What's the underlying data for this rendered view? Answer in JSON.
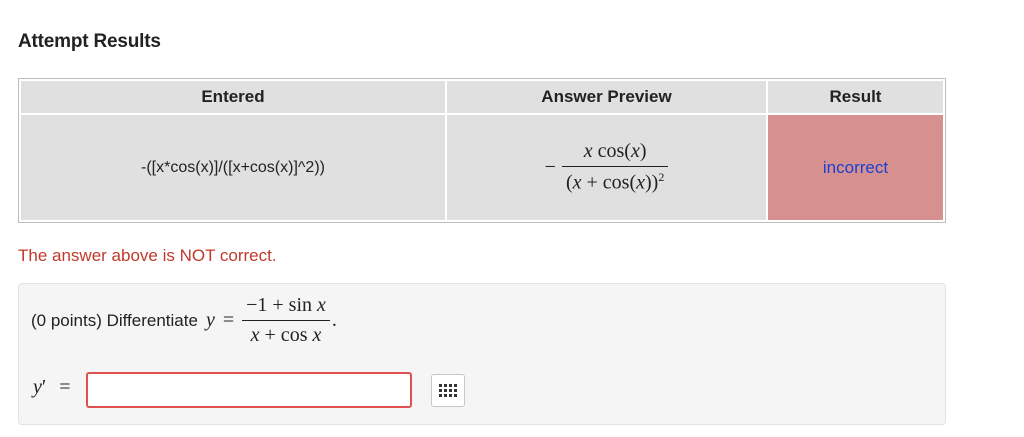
{
  "page": {
    "title": "Attempt Results"
  },
  "table": {
    "headers": {
      "entered": "Entered",
      "preview": "Answer Preview",
      "result": "Result"
    },
    "row": {
      "entered": "-([x*cos(x)]/([x+cos(x)]^2))",
      "preview": {
        "sign": "−",
        "numerator": [
          "x",
          " cos(",
          "x",
          ")"
        ],
        "denominator": [
          "(",
          "x",
          " + cos(",
          "x",
          "))"
        ],
        "exponent": "2"
      },
      "result": "incorrect"
    },
    "colors": {
      "header_bg": "#e0e0e0",
      "cell_bg": "#e0e0e0",
      "incorrect_bg": "#d6908f",
      "incorrect_text": "#1a3fd1"
    }
  },
  "message": {
    "text": "The answer above is NOT correct.",
    "color": "#c0392b"
  },
  "problem": {
    "points": "(0 points) Differentiate",
    "var": "y",
    "equals": "=",
    "fraction": {
      "numerator": "−1 + sin",
      "num_var": "x",
      "denominator_var": "x",
      "denominator": " + cos",
      "den_var": "x"
    },
    "period": ".",
    "answer_label": {
      "var": "y",
      "prime": "′",
      "equals": "="
    },
    "answer_value": "",
    "tool_icon": "equation-grid-icon"
  }
}
